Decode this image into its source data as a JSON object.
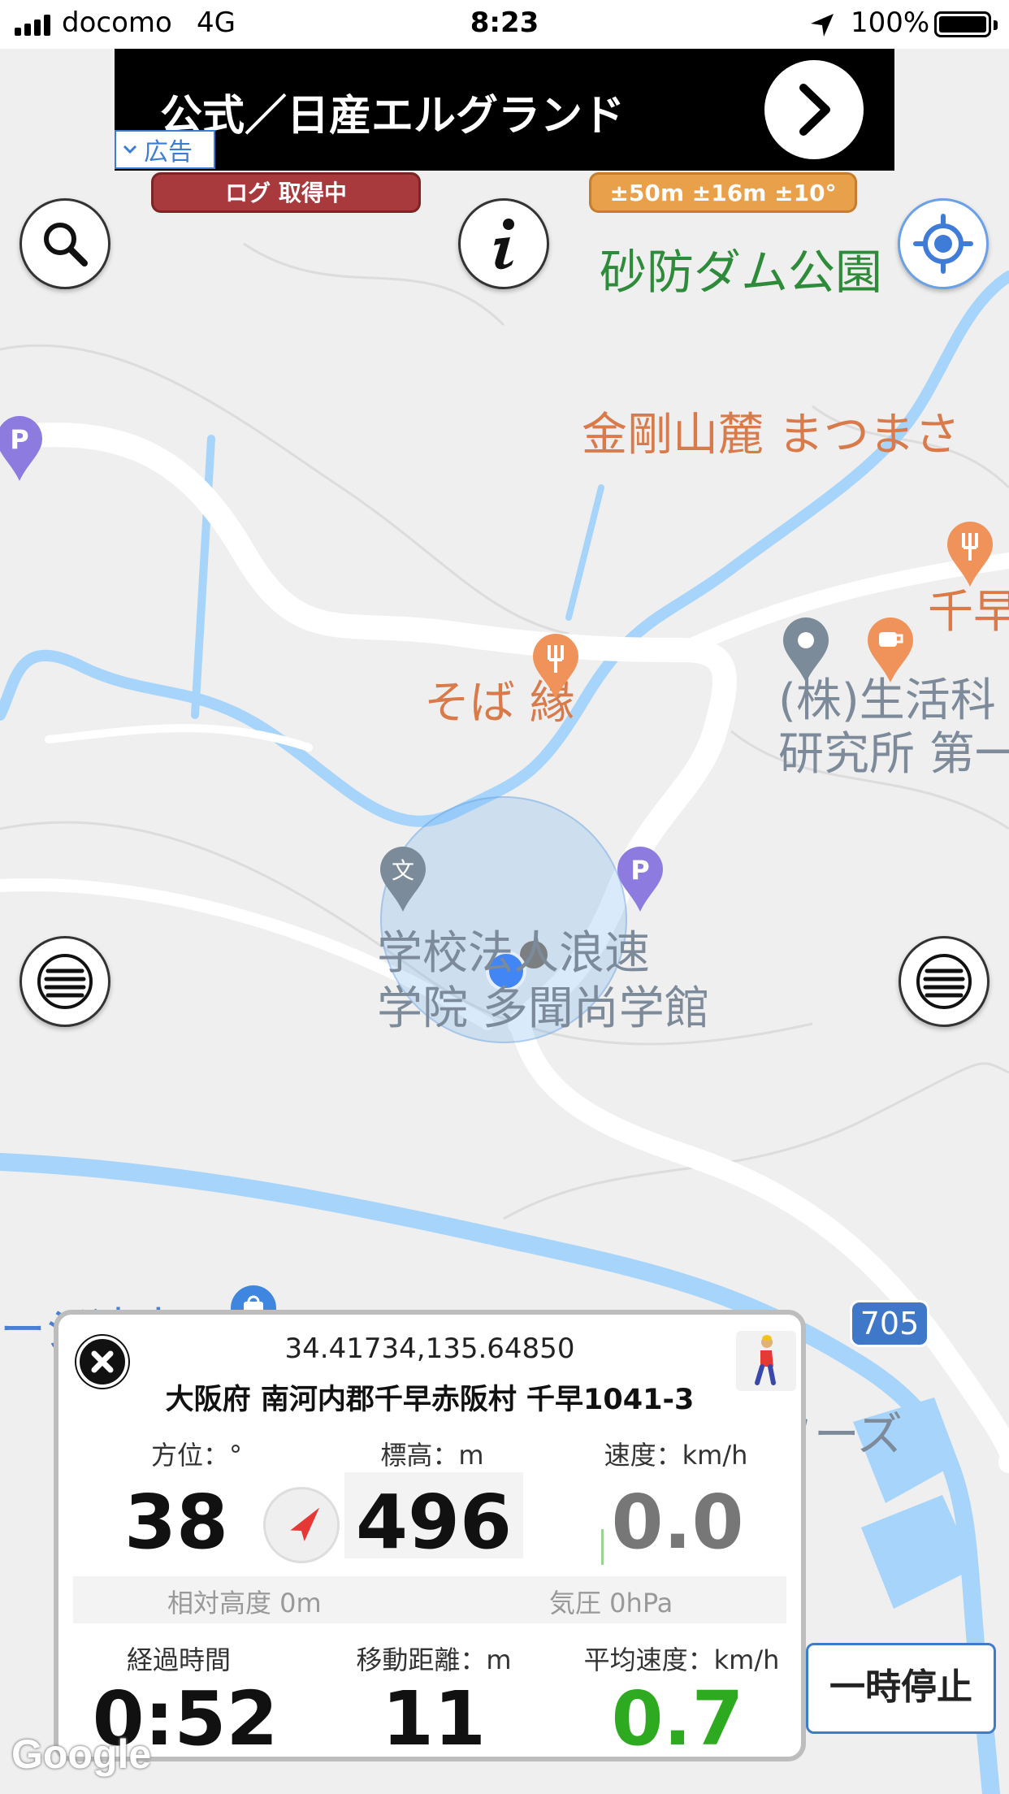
{
  "status_bar": {
    "carrier": "docomo",
    "network": "4G",
    "time": "8:23",
    "battery": "100%"
  },
  "ad": {
    "title": "公式／日産エルグランド",
    "tag": "広告"
  },
  "pills": {
    "log": "ログ 取得中",
    "accuracy": "±50m ±16m ±10°"
  },
  "map": {
    "labels": {
      "park": "砂防ダム公園",
      "restaurant": "金剛山麓 まつまさ",
      "soba": "そば 縁",
      "chihaya": "千早",
      "company_1": "(株)生活科",
      "company_2": "研究所 第一",
      "school_1": "学校法人浪速",
      "school_2": "学院 多聞尚学館",
      "village": "ージ辻本",
      "foods": "(株)ジェイフーズ",
      "route": "705"
    },
    "colors": {
      "river": "#a6d4fa",
      "road": "#ffffff",
      "location": "#4285f4"
    }
  },
  "icons": {
    "search": "search-icon",
    "info": "info-icon",
    "locate": "locate-icon",
    "menu": "menu-icon"
  },
  "panel": {
    "coords": "34.41734,135.64850",
    "address": "大阪府 南河内郡千早赤阪村 千早1041-3",
    "heading_label": "方位：°",
    "heading_value": "38",
    "altitude_label": "標高：m",
    "altitude_value": "496",
    "speed_label": "速度：km/h",
    "speed_value": "0.0",
    "relative_alt": "相対高度 0m",
    "pressure": "気圧 0hPa",
    "elapsed_label": "経過時間",
    "elapsed_value": "0:52",
    "distance_label": "移動距離：m",
    "distance_value": "11",
    "avg_speed_label": "平均速度：km/h",
    "avg_speed_value": "0.7"
  },
  "pause_label": "一時停止",
  "google": "Google"
}
